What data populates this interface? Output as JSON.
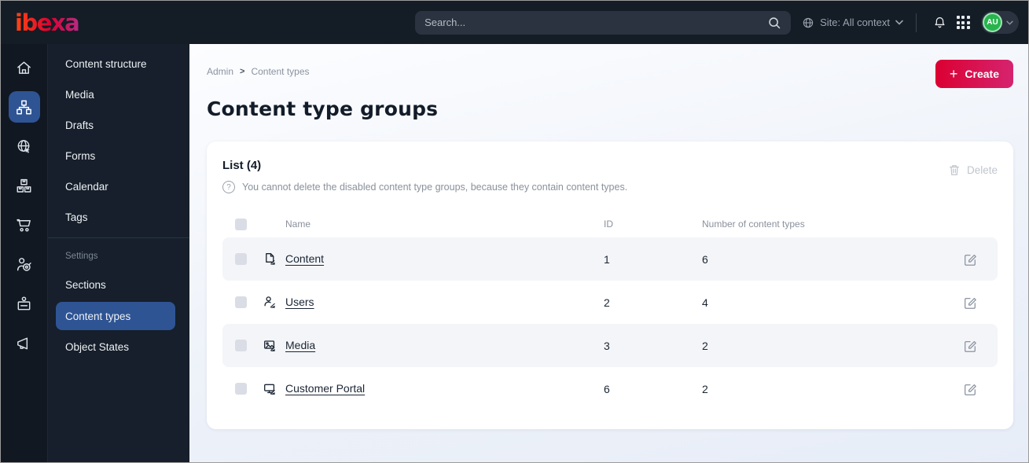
{
  "topbar": {
    "logo_text": "ibexa",
    "search_placeholder": "Search...",
    "site_context_label": "Site: All context",
    "avatar_initials": "AU"
  },
  "sidebar": {
    "rail_icons": [
      "home-icon",
      "content-structure-icon",
      "site-icon",
      "products-icon",
      "commerce-cart-icon",
      "personalization-icon",
      "corporate-icon",
      "campaign-icon"
    ],
    "items": [
      {
        "label": "Content structure"
      },
      {
        "label": "Media"
      },
      {
        "label": "Drafts"
      },
      {
        "label": "Forms"
      },
      {
        "label": "Calendar"
      },
      {
        "label": "Tags"
      }
    ],
    "settings_label": "Settings",
    "settings_items": [
      {
        "label": "Sections",
        "active": false
      },
      {
        "label": "Content types",
        "active": true
      },
      {
        "label": "Object States",
        "active": false
      }
    ]
  },
  "main": {
    "breadcrumb": [
      {
        "label": "Admin"
      },
      {
        "label": "Content types"
      }
    ],
    "create_label": "Create",
    "title": "Content type groups",
    "list": {
      "heading": "List (4)",
      "note": "You cannot delete the disabled content type groups, because they contain content types.",
      "delete_label": "Delete",
      "columns": [
        "Name",
        "ID",
        "Number of content types"
      ],
      "rows": [
        {
          "icon": "content-file-icon",
          "name": "Content",
          "id": "1",
          "count": "6"
        },
        {
          "icon": "users-icon",
          "name": "Users",
          "id": "2",
          "count": "4"
        },
        {
          "icon": "media-image-icon",
          "name": "Media",
          "id": "3",
          "count": "2"
        },
        {
          "icon": "customer-portal-monitor-icon",
          "name": "Customer Portal",
          "id": "6",
          "count": "2"
        }
      ]
    }
  },
  "colors": {
    "topbar_bg": "#141c26",
    "sidebar_bg": "#161f2b",
    "active_blue": "#2e5494",
    "brand_red": "#db0032",
    "brand_pink": "#d5246f",
    "avatar_green": "#28b44d",
    "stripe_gray": "#f4f5f8"
  }
}
